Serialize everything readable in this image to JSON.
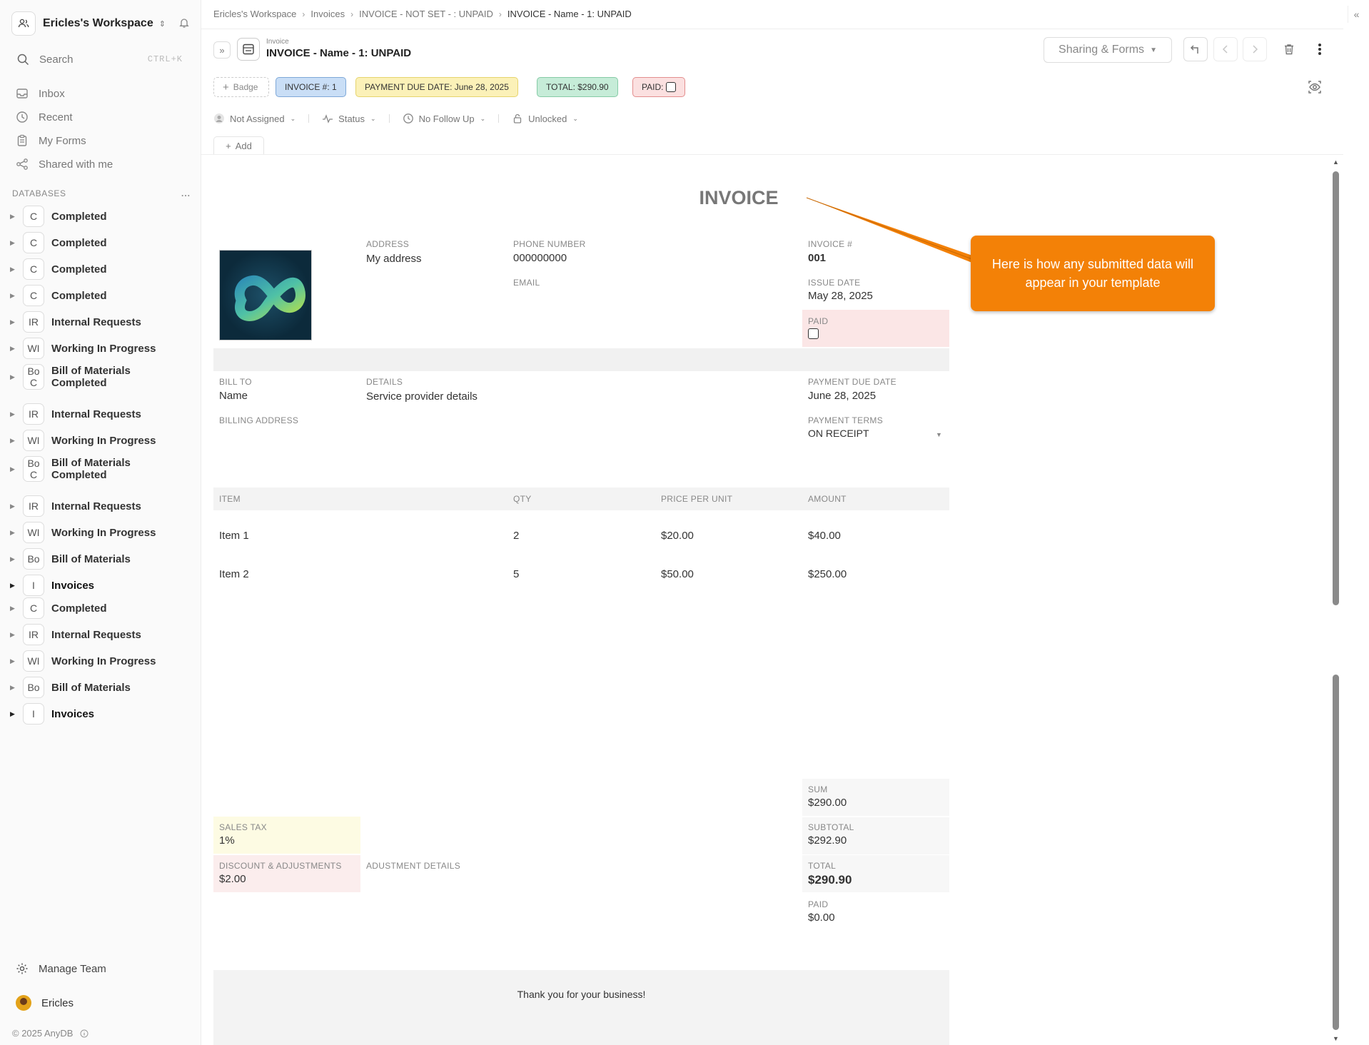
{
  "workspace": {
    "name": "Ericles's Workspace"
  },
  "search": {
    "placeholder": "Search",
    "shortcut": "CTRL+K"
  },
  "nav": [
    {
      "label": "Inbox",
      "icon": "inbox-icon"
    },
    {
      "label": "Recent",
      "icon": "clock-icon"
    },
    {
      "label": "My Forms",
      "icon": "clipboard-icon"
    },
    {
      "label": "Shared with me",
      "icon": "share-icon"
    }
  ],
  "databases": {
    "header": "DATABASES",
    "more": "...",
    "items": [
      {
        "badge": "C",
        "label": "Completed"
      },
      {
        "badge": "C",
        "label": "Completed"
      },
      {
        "badge": "C",
        "label": "Completed"
      },
      {
        "badge": "C",
        "label": "Completed"
      },
      {
        "badge": "IR",
        "label": "Internal Requests"
      },
      {
        "badge": "WI",
        "label": "Working In Progress"
      },
      {
        "badge": "Bo",
        "badge2": "C",
        "label": "Bill of Materials",
        "label2": "Completed"
      },
      {
        "badge": "IR",
        "label": "Internal Requests"
      },
      {
        "badge": "WI",
        "label": "Working In Progress"
      },
      {
        "badge": "Bo",
        "badge2": "C",
        "label": "Bill of Materials",
        "label2": "Completed"
      },
      {
        "badge": "IR",
        "label": "Internal Requests"
      },
      {
        "badge": "WI",
        "label": "Working In Progress"
      },
      {
        "badge": "Bo",
        "label": "Bill of Materials"
      },
      {
        "badge": "I",
        "label": "Invoices"
      },
      {
        "badge": "C",
        "label": "Completed"
      },
      {
        "badge": "IR",
        "label": "Internal Requests"
      },
      {
        "badge": "WI",
        "label": "Working In Progress"
      },
      {
        "badge": "Bo",
        "label": "Bill of Materials"
      },
      {
        "badge": "I",
        "label": "Invoices"
      }
    ]
  },
  "footer": {
    "manage_team": "Manage Team",
    "user": "Ericles",
    "copyright": "© 2025 AnyDB"
  },
  "breadcrumb": [
    "Ericles's Workspace",
    "Invoices",
    "INVOICE - NOT SET - : UNPAID",
    "INVOICE - Name - 1: UNPAID"
  ],
  "record": {
    "type": "Invoice",
    "title": "INVOICE - Name - 1: UNPAID"
  },
  "toolbar": {
    "sharing_label": "Sharing & Forms"
  },
  "chips": {
    "badge": "Badge",
    "invoice_no": "INVOICE #: 1",
    "due_date": "PAYMENT DUE DATE: June 28, 2025",
    "total": "TOTAL: $290.90",
    "paid": "PAID:"
  },
  "meta": {
    "assignee": "Not Assigned",
    "status": "Status",
    "follow_up": "No Follow Up",
    "lock": "Unlocked"
  },
  "add_label": "Add",
  "invoice": {
    "heading": "INVOICE",
    "address_label": "ADDRESS",
    "address": "My address",
    "phone_label": "PHONE NUMBER",
    "phone": "000000000",
    "email_label": "EMAIL",
    "invoice_no_label": "INVOICE #",
    "invoice_no": "001",
    "issue_date_label": "ISSUE DATE",
    "issue_date": "May 28, 2025",
    "paid_label": "PAID",
    "bill_to_label": "BILL TO",
    "bill_to": "Name",
    "details_label": "DETAILS",
    "details": "Service provider details",
    "due_label": "PAYMENT DUE DATE",
    "due": "June 28, 2025",
    "billing_address_label": "BILLING ADDRESS",
    "terms_label": "PAYMENT TERMS",
    "terms": "ON RECEIPT",
    "columns": [
      "ITEM",
      "QTY",
      "PRICE PER UNIT",
      "AMOUNT"
    ],
    "rows": [
      [
        "Item 1",
        "2",
        "$20.00",
        "$40.00"
      ],
      [
        "Item 2",
        "5",
        "$50.00",
        "$250.00"
      ]
    ],
    "sum_label": "SUM",
    "sum": "$290.00",
    "subtotal_label": "SUBTOTAL",
    "subtotal": "$292.90",
    "total_label": "TOTAL",
    "total": "$290.90",
    "paid_amount_label": "PAID",
    "paid_amount": "$0.00",
    "tax_label": "SALES TAX",
    "tax": "1%",
    "discount_label": "DISCOUNT & ADJUSTMENTS",
    "discount": "$2.00",
    "adjust_label": "ADUSTMENT DETAILS",
    "thanks": "Thank you for your business!"
  },
  "callout": "Here is how any submitted data will appear in your template",
  "colors": {
    "callout": "#f38107",
    "invoice_chip": "#c9def6",
    "due_chip": "#fbf1b8",
    "total_chip": "#c6ecd8",
    "paid_chip": "#fbe0e0"
  }
}
